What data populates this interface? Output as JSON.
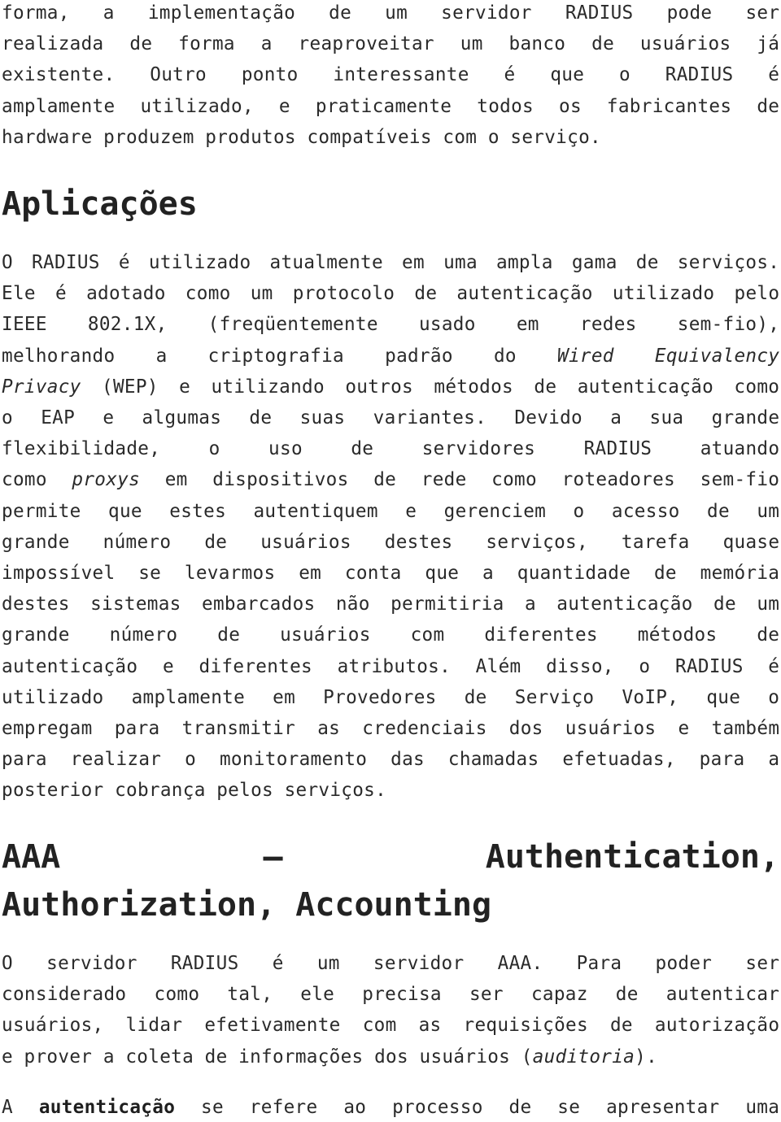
{
  "intro_paragraph": {
    "lines": [
      "forma, a implementação de um servidor RADIUS pode ser",
      "realizada de forma a reaproveitar um banco de usuários já",
      "existente. Outro ponto interessante é que o RADIUS é",
      "amplamente utilizado, e praticamente todos os fabricantes de",
      "hardware produzem produtos compatíveis com o serviço."
    ]
  },
  "section_aplicacoes": {
    "heading": "Aplicações",
    "lines": [
      {
        "parts": [
          {
            "t": "O RADIUS é utilizado atualmente em uma ampla gama de serviços."
          }
        ]
      },
      {
        "parts": [
          {
            "t": "Ele é adotado como um protocolo de autenticação utilizado pelo"
          }
        ]
      },
      {
        "parts": [
          {
            "t": "IEEE 802.1X, (freqüentemente usado em redes sem-fio),"
          }
        ]
      },
      {
        "parts": [
          {
            "t": "melhorando a criptografia padrão do "
          },
          {
            "t": "Wired Equivalency",
            "i": true
          }
        ]
      },
      {
        "parts": [
          {
            "t": "Privacy",
            "i": true
          },
          {
            "t": " (WEP) e utilizando outros métodos de autenticação como"
          }
        ]
      },
      {
        "parts": [
          {
            "t": "o EAP e algumas de suas variantes. Devido a sua grande"
          }
        ]
      },
      {
        "parts": [
          {
            "t": "flexibilidade, o uso de servidores RADIUS atuando"
          }
        ]
      },
      {
        "parts": [
          {
            "t": "como "
          },
          {
            "t": "proxys",
            "i": true
          },
          {
            "t": " em dispositivos de rede como roteadores sem-fio"
          }
        ]
      },
      {
        "parts": [
          {
            "t": "permite que estes autentiquem e gerenciem o acesso de um"
          }
        ]
      },
      {
        "parts": [
          {
            "t": "grande número de usuários destes serviços, tarefa quase"
          }
        ]
      },
      {
        "parts": [
          {
            "t": "impossível se levarmos em conta que a quantidade de memória"
          }
        ]
      },
      {
        "parts": [
          {
            "t": "destes sistemas embarcados não permitiria a autenticação de um"
          }
        ]
      },
      {
        "parts": [
          {
            "t": "grande número de usuários com diferentes métodos de"
          }
        ]
      },
      {
        "parts": [
          {
            "t": "autenticação e diferentes atributos. Além disso, o RADIUS é"
          }
        ]
      },
      {
        "parts": [
          {
            "t": "utilizado amplamente em Provedores de Serviço VoIP, que o"
          }
        ]
      },
      {
        "parts": [
          {
            "t": "empregam para transmitir as credenciais dos usuários e também"
          }
        ]
      },
      {
        "parts": [
          {
            "t": "para realizar o monitoramento das chamadas efetuadas, para a"
          }
        ]
      },
      {
        "parts": [
          {
            "t": "posterior cobrança pelos serviços."
          }
        ],
        "last": true
      }
    ]
  },
  "section_aaa": {
    "heading_line1": [
      "AAA",
      "–",
      "Authentication,"
    ],
    "heading_line2": "Authorization, Accounting",
    "paragraph1": [
      {
        "parts": [
          {
            "t": "O servidor RADIUS é um servidor AAA. Para poder ser"
          }
        ]
      },
      {
        "parts": [
          {
            "t": "considerado como tal, ele precisa ser capaz de autenticar"
          }
        ]
      },
      {
        "parts": [
          {
            "t": "usuários, lidar efetivamente com as requisições de autorização"
          }
        ]
      },
      {
        "parts": [
          {
            "t": "e prover a coleta de informações dos usuários ("
          },
          {
            "t": "auditoria",
            "i": true
          },
          {
            "t": ")."
          }
        ],
        "last": true
      }
    ],
    "paragraph2": [
      {
        "parts": [
          {
            "t": "A "
          },
          {
            "t": "autenticação",
            "b": true
          },
          {
            "t": " se refere ao processo de se apresentar uma"
          }
        ]
      }
    ]
  }
}
